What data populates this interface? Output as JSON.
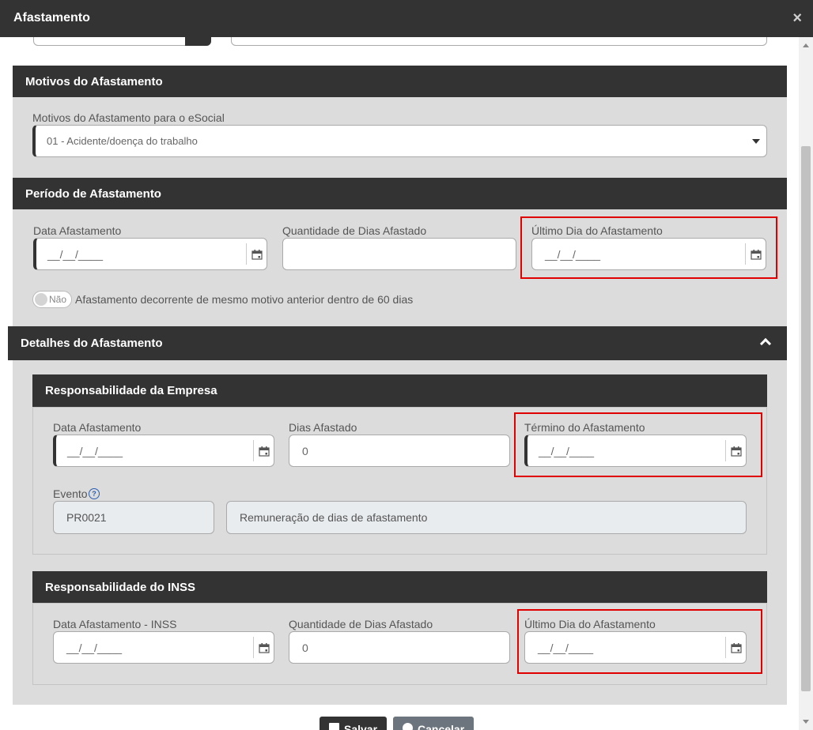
{
  "window": {
    "title": "Afastamento",
    "close_glyph": "×"
  },
  "motivos": {
    "header": "Motivos do Afastamento",
    "field_label": "Motivos do Afastamento para o eSocial",
    "selected": "01 - Acidente/doença do trabalho"
  },
  "periodo": {
    "header": "Período de Afastamento",
    "data_label": "Data Afastamento",
    "data_value": "__/__/____",
    "qtd_label": "Quantidade de Dias Afastado",
    "qtd_value": "",
    "ultimo_label": "Último Dia do Afastamento",
    "ultimo_value": "__/__/____",
    "toggle_text": "Não",
    "toggle_label": "Afastamento decorrente de mesmo motivo anterior dentro de 60 dias"
  },
  "detalhes": {
    "header": "Detalhes do Afastamento",
    "empresa": {
      "header": "Responsabilidade da Empresa",
      "data_label": "Data Afastamento",
      "data_value": "__/__/____",
      "dias_label": "Dias Afastado",
      "dias_value": "0",
      "termino_label": "Término do Afastamento",
      "termino_value": "__/__/____",
      "evento_label": "Evento",
      "evento_code": "PR0021",
      "evento_desc": "Remuneração de dias de afastamento"
    },
    "inss": {
      "header": "Responsabilidade do INSS",
      "data_label": "Data Afastamento - INSS",
      "data_value": "__/__/____",
      "qtd_label": "Quantidade de Dias Afastado",
      "qtd_value": "0",
      "ultimo_label": "Último Dia do Afastamento",
      "ultimo_value": "__/__/____"
    }
  },
  "footer": {
    "save_label": "Salvar",
    "cancel_label": "Cancelar"
  },
  "colors": {
    "header_bg": "#333333",
    "panel_bg": "#dcdcdc",
    "highlight": "#e00000"
  }
}
